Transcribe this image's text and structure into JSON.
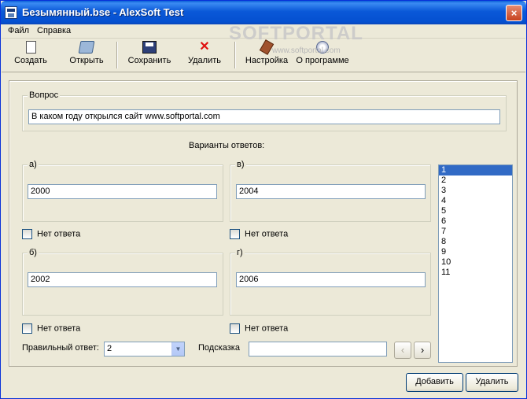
{
  "window": {
    "title": "Безымянный.bse - AlexSoft Test",
    "close_label": "×"
  },
  "watermark": {
    "main": "SOFTPORTAL",
    "sub": "www.softportal.com"
  },
  "menu": {
    "items": [
      {
        "label": "Файл"
      },
      {
        "label": "Справка"
      }
    ]
  },
  "toolbar": {
    "create": "Создать",
    "open": "Открыть",
    "save": "Сохранить",
    "delete": "Удалить",
    "settings": "Настройка",
    "about": "О программе"
  },
  "question": {
    "group_label": "Вопрос",
    "value": "В каком году открылся сайт www.softportal.com"
  },
  "answers": {
    "heading": "Варианты ответов:",
    "a": {
      "label": "а)",
      "value": "2000",
      "no_answer": "Нет ответа"
    },
    "v": {
      "label": "в)",
      "value": "2004",
      "no_answer": "Нет ответа"
    },
    "b": {
      "label": "б)",
      "value": "2002",
      "no_answer": "Нет ответа"
    },
    "g": {
      "label": "г)",
      "value": "2006",
      "no_answer": "Нет ответа"
    }
  },
  "correct_answer": {
    "label": "Правильный ответ:",
    "value": "2"
  },
  "hint": {
    "label": "Подсказка",
    "value": ""
  },
  "nav": {
    "prev": "‹",
    "next": "›"
  },
  "list": {
    "items": [
      "1",
      "2",
      "3",
      "4",
      "5",
      "6",
      "7",
      "8",
      "9",
      "10",
      "11"
    ],
    "selected_index": 0
  },
  "buttons": {
    "add": "Добавить",
    "remove": "Удалить"
  }
}
